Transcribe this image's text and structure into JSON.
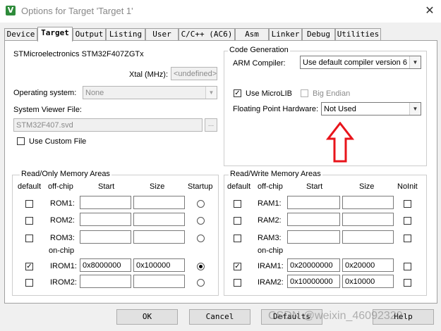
{
  "window": {
    "title": "Options for Target 'Target 1'",
    "app_icon": "V"
  },
  "tabs": [
    "Device",
    "Target",
    "Output",
    "Listing",
    "User",
    "C/C++ (AC6)",
    "Asm",
    "Linker",
    "Debug",
    "Utilities"
  ],
  "active_tab": "Target",
  "device_name": "STMicroelectronics STM32F407ZGTx",
  "xtal": {
    "label": "Xtal (MHz):",
    "value": "<undefined>"
  },
  "os": {
    "label": "Operating system:",
    "value": "None"
  },
  "svd": {
    "label": "System Viewer File:",
    "value": "STM32F407.svd",
    "browse": "..."
  },
  "use_custom_file": {
    "label": "Use Custom File",
    "checked": false
  },
  "code_gen": {
    "title": "Code Generation",
    "compiler_label": "ARM Compiler:",
    "compiler_value": "Use default compiler version 6",
    "microlib_label": "Use MicroLIB",
    "microlib_checked": true,
    "big_endian_label": "Big Endian",
    "fph_label": "Floating Point Hardware:",
    "fph_value": "Not Used"
  },
  "ro_mem": {
    "title": "Read/Only Memory Areas",
    "headers": {
      "default": "default",
      "offchip": "off-chip",
      "start": "Start",
      "size": "Size",
      "startup": "Startup"
    },
    "onchip_label": "on-chip",
    "rows": [
      {
        "name": "ROM1:",
        "default": false,
        "start": "",
        "size": "",
        "startup": false
      },
      {
        "name": "ROM2:",
        "default": false,
        "start": "",
        "size": "",
        "startup": false
      },
      {
        "name": "ROM3:",
        "default": false,
        "start": "",
        "size": "",
        "startup": false
      },
      {
        "name": "IROM1:",
        "default": true,
        "start": "0x8000000",
        "size": "0x100000",
        "startup": true
      },
      {
        "name": "IROM2:",
        "default": false,
        "start": "",
        "size": "",
        "startup": false
      }
    ]
  },
  "rw_mem": {
    "title": "Read/Write Memory Areas",
    "headers": {
      "default": "default",
      "offchip": "off-chip",
      "start": "Start",
      "size": "Size",
      "noinit": "NoInit"
    },
    "onchip_label": "on-chip",
    "rows": [
      {
        "name": "RAM1:",
        "default": false,
        "start": "",
        "size": "",
        "noinit": false
      },
      {
        "name": "RAM2:",
        "default": false,
        "start": "",
        "size": "",
        "noinit": false
      },
      {
        "name": "RAM3:",
        "default": false,
        "start": "",
        "size": "",
        "noinit": false
      },
      {
        "name": "IRAM1:",
        "default": true,
        "start": "0x20000000",
        "size": "0x20000",
        "noinit": false
      },
      {
        "name": "IRAM2:",
        "default": false,
        "start": "0x10000000",
        "size": "0x10000",
        "noinit": false
      }
    ]
  },
  "buttons": {
    "ok": "OK",
    "cancel": "Cancel",
    "defaults": "Defaults",
    "help": "Help"
  },
  "annotation": {
    "arrow_color": "#e8141b"
  },
  "watermark": "CSDN @weixin_46092320"
}
